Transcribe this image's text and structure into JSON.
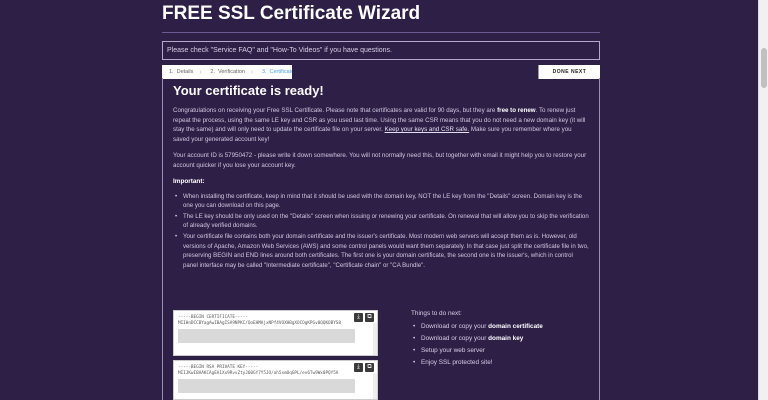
{
  "header": {
    "title": "FREE SSL Certificate Wizard"
  },
  "info_bar": {
    "text": "Please check \"Service FAQ\" and \"How-To Videos\" if you have questions."
  },
  "steps": [
    {
      "num": "1.",
      "label": "Details"
    },
    {
      "num": "2.",
      "label": "Verification"
    },
    {
      "num": "3.",
      "label": "Certificate"
    }
  ],
  "done_button": "DONE NEXT",
  "main": {
    "heading": "Your certificate is ready!",
    "congrats_part1": "Congratulations on receiving your Free SSL Certificate. Please note that certificates are valid for 90 days, but they are ",
    "congrats_bold": "free to renew",
    "congrats_part2": ". To renew just repeat the process, using the same LE key and CSR as you used last time. Using the same CSR means that you do not need a new domain key (it will stay the same) and will only need to update the certificate file on your server. ",
    "congrats_link": "Keep your keys and CSR safe.",
    "congrats_part3": " Make sure you remember where you saved your generated account key!",
    "account_text": "Your account ID is 57950472 - please write it down somewhere. You will not normally need this, but together with email it might help you to restore your account quicker if you lose your account key.",
    "important_heading": "Important:",
    "important_items": [
      "When installing the certificate, keep in mind that it should be used with the domain key, NOT the LE key from the \"Details\" screen. Domain key is the one you can download on this page.",
      "The LE key should be only used on the \"Details\" screen when issuing or renewing your certificate. On renewal that will allow you to skip the verification of already verified domains.",
      "Your certificate file contains both your domain certificate and the issuer's certificate. Most modern web servers will accept them as is. However, old versions of Apache, Amazon Web Services (AWS) and some control panels would want them separately. In that case just split the certificate file in two, preserving BEGIN and END lines around both certificates. The first one is your domain certificate, the second one is the issuer's, which in control panel interface may be called \"Intermediate certificate\", \"Certificate chain\" or \"CA Bundle\"."
    ]
  },
  "cert_box": {
    "line1": "-----BEGIN CERTIFICATE-----",
    "line2": "MIIHnDCCBYagAwIBAgISA9NPKC/QoEHMAjxNPf4VOXHBgXOCOgKPGv0QQKOBYS8"
  },
  "key_box": {
    "line1": "-----BEGIN RSA PRIVATE KEY-----",
    "line2": "MIIJKwIBAAKCAgEA1Xx9RvvZtyJ60GY7Y5JO/oh5xmOqGPL/ev6Tw9Wx0PQY5A"
  },
  "todo": {
    "heading": "Things to do next:",
    "items": [
      {
        "prefix": "Download or copy your ",
        "bold": "domain certificate"
      },
      {
        "prefix": "Download or copy your ",
        "bold": "domain key"
      },
      {
        "prefix": "Setup your web server",
        "bold": ""
      },
      {
        "prefix": "Enjoy SSL protected site!",
        "bold": ""
      }
    ]
  },
  "icons": {
    "download": "download-icon",
    "copy": "copy-icon"
  }
}
